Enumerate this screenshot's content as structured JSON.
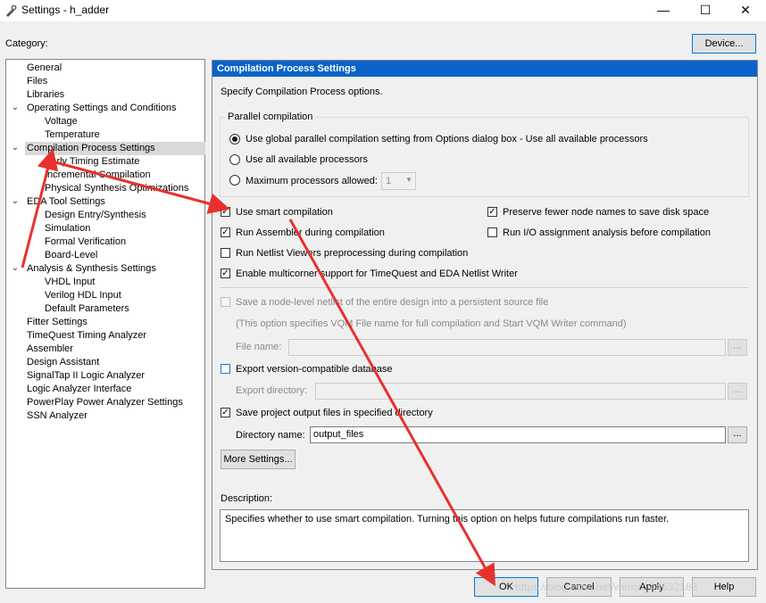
{
  "window": {
    "title": "Settings - h_adder",
    "minimize_glyph": "—",
    "maximize_glyph": "☐",
    "close_glyph": "✕"
  },
  "category_label": "Category:",
  "device_button": "Device...",
  "tree": {
    "items": [
      {
        "label": "General"
      },
      {
        "label": "Files"
      },
      {
        "label": "Libraries"
      },
      {
        "label": "Operating Settings and Conditions"
      },
      {
        "label": "Voltage"
      },
      {
        "label": "Temperature"
      },
      {
        "label": "Compilation Process Settings"
      },
      {
        "label": "Early Timing Estimate"
      },
      {
        "label": "Incremental Compilation"
      },
      {
        "label": "Physical Synthesis Optimizations"
      },
      {
        "label": "EDA Tool Settings"
      },
      {
        "label": "Design Entry/Synthesis"
      },
      {
        "label": "Simulation"
      },
      {
        "label": "Formal Verification"
      },
      {
        "label": "Board-Level"
      },
      {
        "label": "Analysis & Synthesis Settings"
      },
      {
        "label": "VHDL Input"
      },
      {
        "label": "Verilog HDL Input"
      },
      {
        "label": "Default Parameters"
      },
      {
        "label": "Fitter Settings"
      },
      {
        "label": "TimeQuest Timing Analyzer"
      },
      {
        "label": "Assembler"
      },
      {
        "label": "Design Assistant"
      },
      {
        "label": "SignalTap II Logic Analyzer"
      },
      {
        "label": "Logic Analyzer Interface"
      },
      {
        "label": "PowerPlay Power Analyzer Settings"
      },
      {
        "label": "SSN Analyzer"
      }
    ],
    "selected": "Compilation Process Settings"
  },
  "panel": {
    "header": "Compilation Process Settings",
    "intro": "Specify Compilation Process options.",
    "parallel": {
      "group_label": "Parallel compilation",
      "option_global": "Use global parallel compilation setting from Options dialog box - Use all available processors",
      "option_all": "Use all available processors",
      "option_max": "Maximum processors allowed:",
      "max_value": "1",
      "selected": "global"
    },
    "options": {
      "smart_compilation": {
        "label": "Use smart compilation",
        "checked": true
      },
      "preserve_fewer": {
        "label": "Preserve fewer node names to save disk space",
        "checked": true
      },
      "run_assembler": {
        "label": "Run Assembler during compilation",
        "checked": true
      },
      "run_io": {
        "label": "Run I/O assignment analysis before compilation",
        "checked": false
      },
      "run_netlist_viewers": {
        "label": "Run Netlist Viewers preprocessing during compilation",
        "checked": false
      },
      "multicorner": {
        "label": "Enable multicorner support for TimeQuest and EDA Netlist Writer",
        "checked": true
      }
    },
    "vqm": {
      "checkbox_label": "Save a node-level netlist of the entire design into a persistent source file",
      "note": "(This option specifies VQM File name for full compilation and Start VQM Writer command)",
      "file_name_label": "File name:"
    },
    "export": {
      "checkbox_label": "Export version-compatible database",
      "dir_label": "Export directory:"
    },
    "save_output": {
      "checkbox_label": "Save project output files in specified directory",
      "checked": true,
      "dir_label": "Directory name:",
      "dir_value": "output_files"
    },
    "browse_label": "...",
    "more_settings": "More Settings...",
    "description_label": "Description:",
    "description_text": "Specifies whether to use smart compilation. Turning this option on helps future compilations run faster."
  },
  "buttons": {
    "ok": "OK",
    "cancel": "Cancel",
    "apply": "Apply",
    "help": "Help"
  },
  "watermark": "https://blog.csdn.net/weixin_44632183",
  "annotation_color": "#e8312f"
}
